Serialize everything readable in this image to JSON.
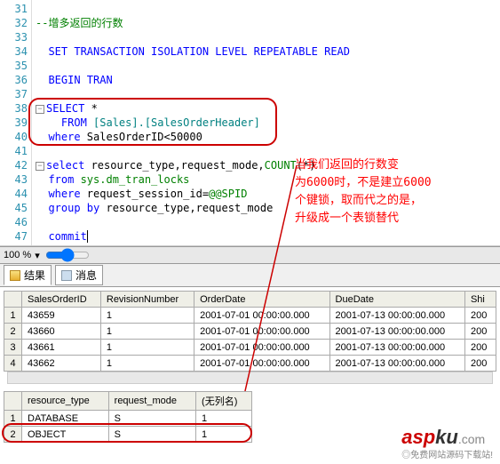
{
  "gutter": [
    "31",
    "32",
    "33",
    "34",
    "35",
    "36",
    "37",
    "38",
    "39",
    "40",
    "41",
    "42",
    "43",
    "44",
    "45",
    "46",
    "47"
  ],
  "code": {
    "l32": "--增多返回的行数",
    "l34_kw": "SET TRANSACTION ISOLATION LEVEL REPEATABLE READ",
    "l36_kw": "BEGIN TRAN",
    "l38_kw": "SELECT",
    "l38_star": " *",
    "l39_kw": "FROM",
    "l39_obj": " [Sales].[SalesOrderHeader]",
    "l40_kw": "where",
    "l40_col": " SalesOrderID",
    "l40_op": "<",
    "l40_num": "50000",
    "l42_kw": "select",
    "l42_cols": " resource_type,request_mode,",
    "l42_fn": "COUNT",
    "l42_paren": "(*)",
    "l43_kw": "from",
    "l43_tbl": " sys.dm_tran_locks",
    "l44_kw": "where",
    "l44_col": " request_session_id",
    "l44_eq": "=",
    "l44_var": "@@SPID",
    "l45_kw": "group by",
    "l45_cols": " resource_type,request_mode",
    "l47_kw": "commit"
  },
  "annotation": {
    "l1": "当我们返回的行数变",
    "l2": "为6000时，不是建立6000",
    "l3": "个键锁，取而代之的是，",
    "l4": "升级成一个表锁替代"
  },
  "zoom": "100 %",
  "tabs": {
    "results": "结果",
    "messages": "消息"
  },
  "grid1": {
    "headers": [
      "SalesOrderID",
      "RevisionNumber",
      "OrderDate",
      "DueDate",
      "Shi"
    ],
    "rows": [
      [
        "1",
        "43659",
        "1",
        "2001-07-01 00:00:00.000",
        "2001-07-13 00:00:00.000",
        "200"
      ],
      [
        "2",
        "43660",
        "1",
        "2001-07-01 00:00:00.000",
        "2001-07-13 00:00:00.000",
        "200"
      ],
      [
        "3",
        "43661",
        "1",
        "2001-07-01 00:00:00.000",
        "2001-07-13 00:00:00.000",
        "200"
      ],
      [
        "4",
        "43662",
        "1",
        "2001-07-01 00:00:00.000",
        "2001-07-13 00:00:00.000",
        "200"
      ]
    ]
  },
  "grid2": {
    "headers": [
      "resource_type",
      "request_mode",
      "(无列名)"
    ],
    "rows": [
      [
        "1",
        "DATABASE",
        "S",
        "1"
      ],
      [
        "2",
        "OBJECT",
        "S",
        "1"
      ]
    ]
  },
  "watermark": {
    "asp": "asp",
    "ku": "ku",
    "com": ".com",
    "sub": "◎免费网站源码下载站!"
  }
}
